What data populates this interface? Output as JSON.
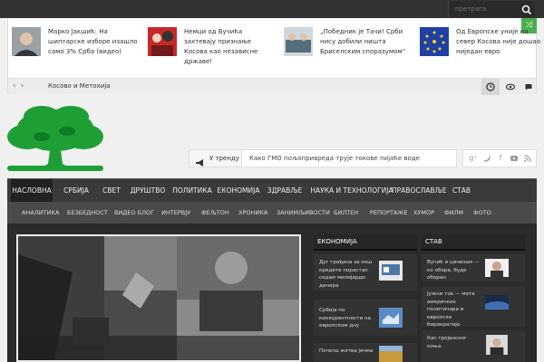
{
  "search": {
    "placeholder": "претрага"
  },
  "ticker": {
    "items": [
      {
        "title": "Марко Јакшић: На шиптарске изборе изашло само 3% Срба (видео)"
      },
      {
        "title": "Немци од Вучића захтевају признање Косова као независне државе!"
      },
      {
        "title": "„Победник је Тачи! Срби нису добили ништа Бриселским споразумом“"
      },
      {
        "title": "Од Европске уније на север Косова није дошао ниједан евро"
      }
    ],
    "category": "Косово и Метохија"
  },
  "trending": {
    "label": "У тренду",
    "text": "Како ГМО пољопривреда трује токове пијаће воде"
  },
  "nav": {
    "main": [
      "НАСЛОВНА",
      "СРБИЈА",
      "СВЕТ",
      "ДРУШТВО",
      "ПОЛИТИКА",
      "ЕКОНОМИЈА",
      "ЗДРАВЉЕ",
      "НАУКА И ТЕХНОЛОГИЈА",
      "ПРАВОСЛАВЉЕ",
      "СТАВ"
    ],
    "sub": [
      "АНАЛИТИКА",
      "БЕЗБЕДНОСТ",
      "ВИДЕО БЛОГ",
      "ИНТЕРВЈУ",
      "ФЕЉТОН",
      "ХРОНИКА",
      "ЗАНИМЉИВОСТИ",
      "БИЛТЕН",
      "РЕПОРТАЖЕ",
      "ХУМОР",
      "ФИЛМ",
      "ФОТО"
    ]
  },
  "widgets": {
    "economy": {
      "title": "ЕКОНОМИЈА",
      "items": [
        "Дуг грађана за кеш кредите порастао седам милијарди динара",
        "Србија по конкурентности на европском дну",
        "Почела жетва јечма"
      ]
    },
    "stav": {
      "title": "СТАВ",
      "items": [
        "Вучић и цинизам — ко обара, буде оборан",
        "Јужни ток — мета америчких политичара и европске бирократије",
        "Кас тројанског коња"
      ]
    }
  },
  "colors": {
    "accent": "#4caf50",
    "nav_bg": "#3a3a3a",
    "nav_active": "#222222",
    "content_bg": "#2b2b2b"
  }
}
